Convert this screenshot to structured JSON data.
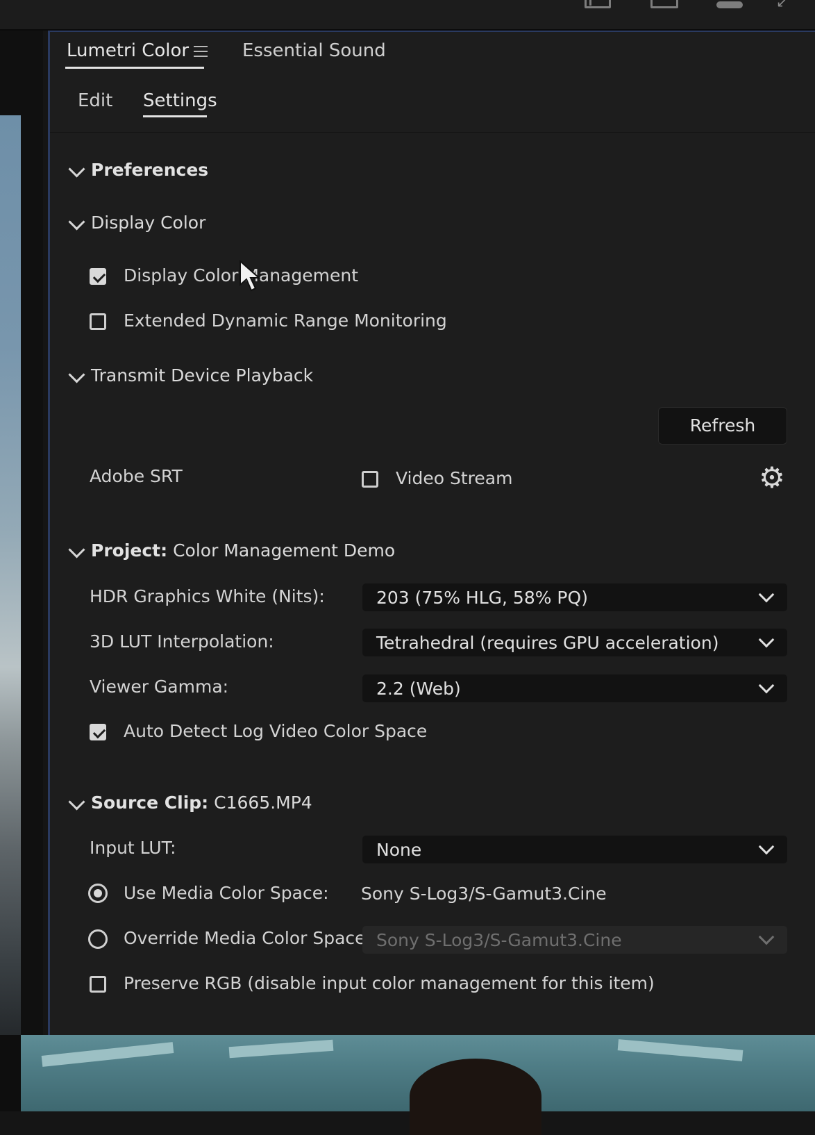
{
  "panel": {
    "tabs": [
      {
        "label": "Lumetri Color",
        "active": true
      },
      {
        "label": "Essential Sound",
        "active": false
      }
    ],
    "subtabs": [
      {
        "label": "Edit",
        "active": false
      },
      {
        "label": "Settings",
        "active": true
      }
    ]
  },
  "sections": {
    "preferences": "Preferences",
    "display_color": "Display Color",
    "transmit": "Transmit Device Playback",
    "project_label": "Project:",
    "project_name": "Color Management Demo",
    "source_label": "Source Clip:",
    "source_name": "C1665.MP4"
  },
  "display_color": {
    "management": {
      "label": "Display Color Management",
      "checked": true
    },
    "hdr_monitoring": {
      "label": "Extended Dynamic Range Monitoring",
      "checked": false
    }
  },
  "transmit": {
    "refresh_label": "Refresh",
    "device_label": "Adobe SRT",
    "video_stream": {
      "label": "Video Stream",
      "checked": false
    },
    "settings_icon": "gear-icon"
  },
  "project": {
    "hdr_white": {
      "label": "HDR Graphics White (Nits):",
      "value": "203 (75% HLG, 58% PQ)"
    },
    "lut_interp": {
      "label": "3D LUT Interpolation:",
      "value": "Tetrahedral (requires GPU acceleration)"
    },
    "viewer_gamma": {
      "label": "Viewer Gamma:",
      "value": "2.2 (Web)"
    },
    "auto_detect": {
      "label": "Auto Detect Log Video Color Space",
      "checked": true
    }
  },
  "source": {
    "input_lut": {
      "label": "Input LUT:",
      "value": "None"
    },
    "use_media": {
      "label": "Use Media Color Space:",
      "value": "Sony S-Log3/S-Gamut3.Cine",
      "selected": true
    },
    "override_media": {
      "label": "Override Media Color Space:",
      "value": "Sony S-Log3/S-Gamut3.Cine",
      "selected": false,
      "disabled": true
    },
    "preserve_rgb": {
      "label": "Preserve RGB (disable input color management for this item)",
      "checked": false
    }
  },
  "colors": {
    "panel_bg": "#1d1d1d",
    "accent_border": "#2a3a60",
    "text": "#d8d8d8"
  }
}
